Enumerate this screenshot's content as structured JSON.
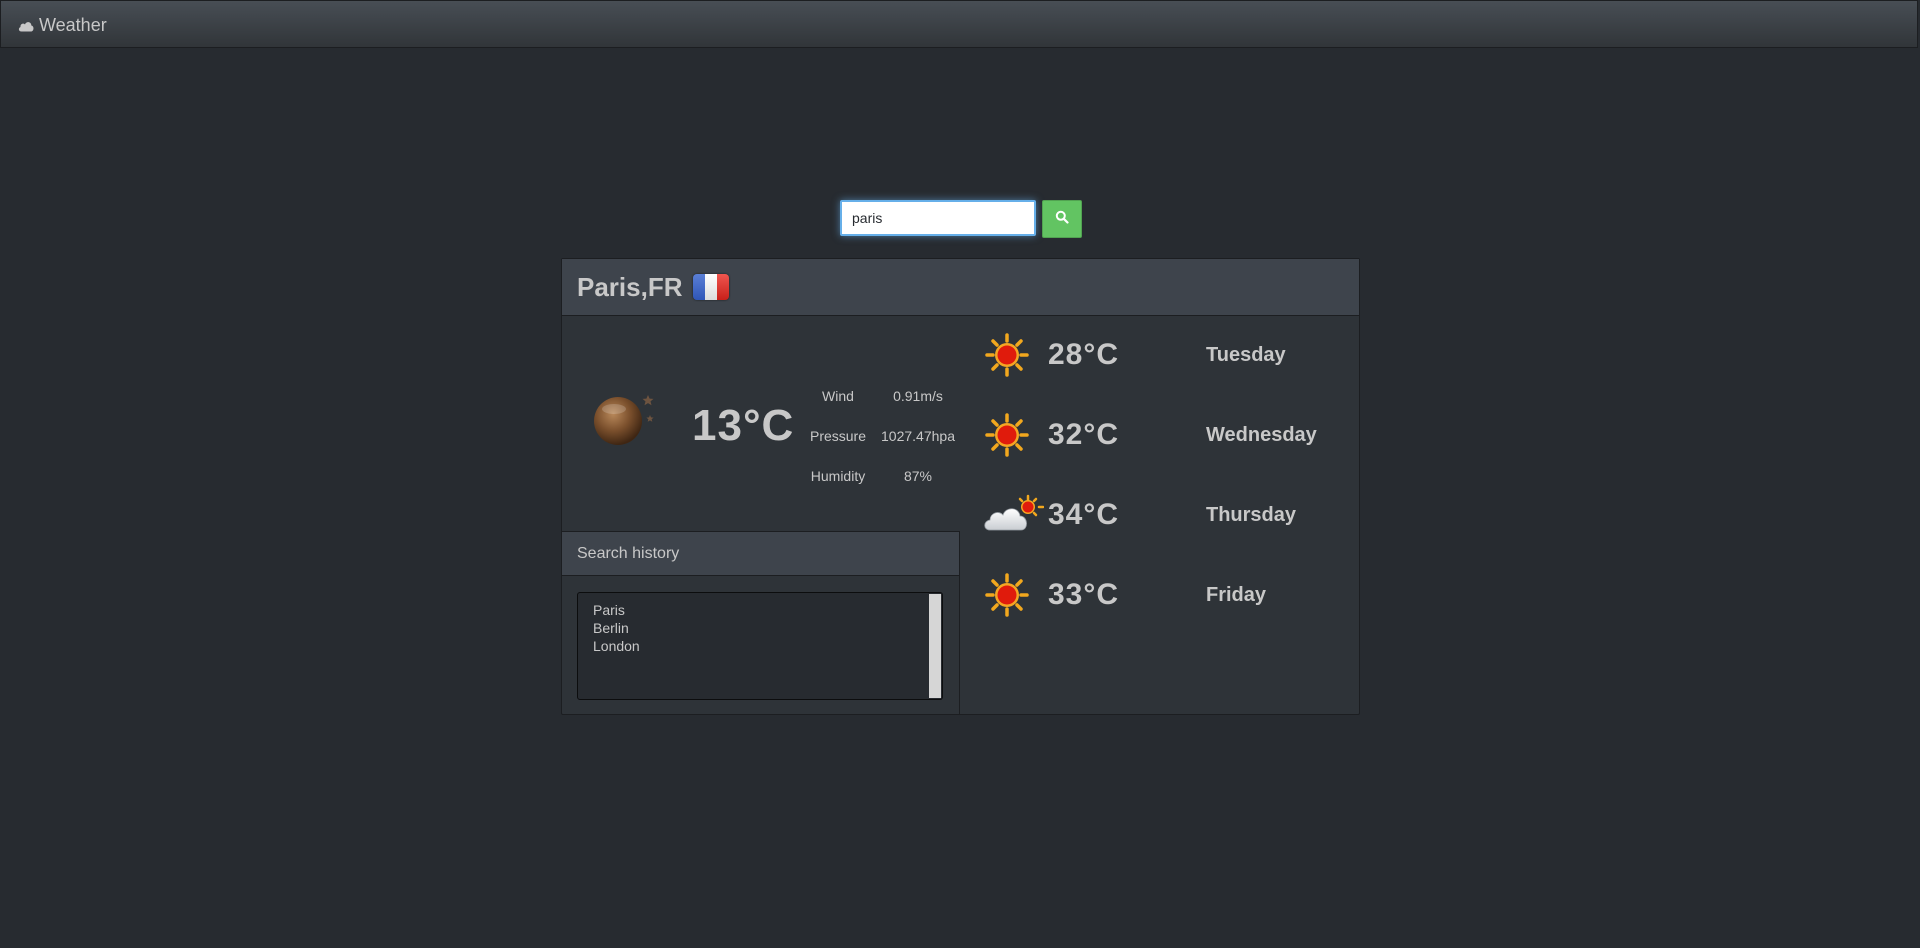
{
  "app": {
    "brand_icon": "cloud-icon",
    "title": "Weather"
  },
  "search": {
    "value": "paris",
    "button_icon": "search-icon",
    "button_color": "#62c462"
  },
  "location": {
    "name": "Paris,FR",
    "flag": "france-flag-icon"
  },
  "current": {
    "icon": "moon-night-icon",
    "temperature": "13°C",
    "details": [
      {
        "label": "Wind",
        "value": "0.91m/s"
      },
      {
        "label": "Pressure",
        "value": "1027.47hpa"
      },
      {
        "label": "Humidity",
        "value": "87%"
      }
    ]
  },
  "history": {
    "title": "Search history",
    "items": [
      "Paris",
      "Berlin",
      "London"
    ]
  },
  "forecast": [
    {
      "icon": "sun-icon",
      "temperature": "28°C",
      "day": "Tuesday"
    },
    {
      "icon": "sun-icon",
      "temperature": "32°C",
      "day": "Wednesday"
    },
    {
      "icon": "cloud-sun-icon",
      "temperature": "34°C",
      "day": "Thursday"
    },
    {
      "icon": "sun-icon",
      "temperature": "33°C",
      "day": "Friday"
    }
  ]
}
